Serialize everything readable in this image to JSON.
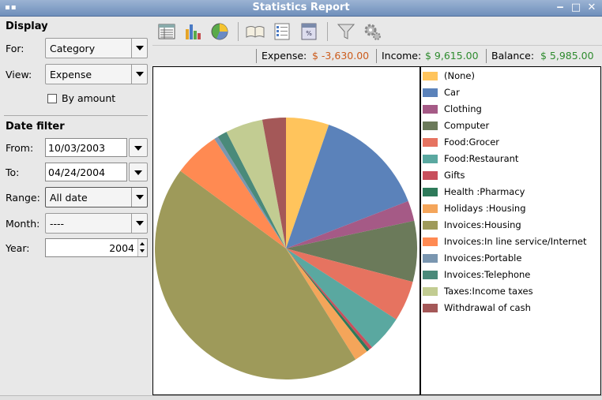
{
  "window": {
    "title": "Statistics Report"
  },
  "display": {
    "heading": "Display",
    "for_label": "For:",
    "for_value": "Category",
    "view_label": "View:",
    "view_value": "Expense",
    "by_amount_label": "By amount"
  },
  "date_filter": {
    "heading": "Date filter",
    "from_label": "From:",
    "from_value": "10/03/2003",
    "to_label": "To:",
    "to_value": "04/24/2004",
    "range_label": "Range:",
    "range_value": "All date",
    "month_label": "Month:",
    "month_value": "----",
    "year_label": "Year:",
    "year_value": "2004"
  },
  "summary": {
    "expense_label": "Expense:",
    "expense_value": "$ -3,630.00",
    "income_label": "Income:",
    "income_value": "$ 9,615.00",
    "balance_label": "Balance:",
    "balance_value": "$ 5,985.00"
  },
  "toolbar": {
    "icons": [
      "list-view-icon",
      "bar-chart-icon",
      "pie-chart-icon",
      "book-icon",
      "checklist-icon",
      "rate-icon",
      "filter-icon",
      "gear-icon"
    ]
  },
  "chart_data": {
    "type": "pie",
    "slices": [
      {
        "name": "(None)",
        "value": 5.3,
        "color": "#ffc45c"
      },
      {
        "name": "Car",
        "value": 13.8,
        "color": "#5b82ba"
      },
      {
        "name": "Clothing",
        "value": 2.5,
        "color": "#a55a86"
      },
      {
        "name": "Computer",
        "value": 7.5,
        "color": "#6b7a5a"
      },
      {
        "name": "Food:Grocer",
        "value": 5.0,
        "color": "#e67360"
      },
      {
        "name": "Food:Restaurant",
        "value": 4.5,
        "color": "#5aa8a0"
      },
      {
        "name": "Gifts",
        "value": 0.4,
        "color": "#c84f5c"
      },
      {
        "name": "Health :Pharmacy",
        "value": 0.4,
        "color": "#2e7a5a"
      },
      {
        "name": "Holidays :Housing",
        "value": 1.7,
        "color": "#f4a55a"
      },
      {
        "name": "Invoices:Housing",
        "value": 44.0,
        "color": "#9e9a5a"
      },
      {
        "name": "Invoices:In line service/Internet",
        "value": 5.7,
        "color": "#ff8a52"
      },
      {
        "name": "Invoices:Portable",
        "value": 0.5,
        "color": "#7a96b0"
      },
      {
        "name": "Invoices:Telephone",
        "value": 1.2,
        "color": "#4a8a7a"
      },
      {
        "name": "Taxes:Income taxes",
        "value": 4.6,
        "color": "#c2cc92"
      },
      {
        "name": "Withdrawal of cash",
        "value": 2.9,
        "color": "#a45858"
      }
    ]
  }
}
